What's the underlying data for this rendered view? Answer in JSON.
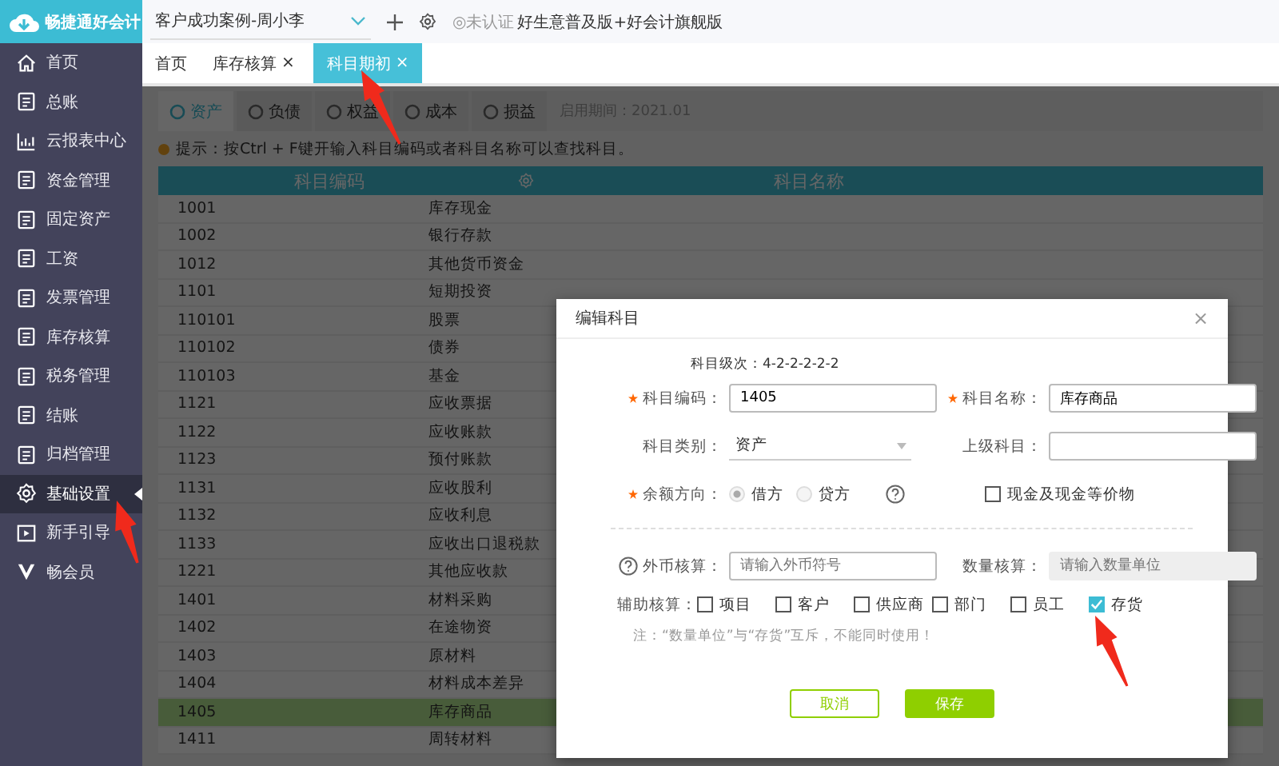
{
  "app": {
    "logo": "畅捷通好会计"
  },
  "sidebar": {
    "items": [
      {
        "label": "首页",
        "selected": false
      },
      {
        "label": "总账",
        "selected": false
      },
      {
        "label": "云报表中心",
        "selected": false
      },
      {
        "label": "资金管理",
        "selected": false
      },
      {
        "label": "固定资产",
        "selected": false
      },
      {
        "label": "工资",
        "selected": false
      },
      {
        "label": "发票管理",
        "selected": false
      },
      {
        "label": "库存核算",
        "selected": false
      },
      {
        "label": "税务管理",
        "selected": false
      },
      {
        "label": "结账",
        "selected": false
      },
      {
        "label": "归档管理",
        "selected": false
      },
      {
        "label": "基础设置",
        "selected": true
      },
      {
        "label": "新手引导",
        "selected": false
      },
      {
        "label": "畅会员",
        "selected": false
      }
    ]
  },
  "topbar": {
    "account": "客户成功案例-周小李",
    "cert": "◎未认证",
    "edition": "好生意普及版+好会计旗舰版"
  },
  "tabs": [
    {
      "label": "首页",
      "selected": false
    },
    {
      "label": "库存核算",
      "close": "×",
      "selected": false
    },
    {
      "label": "科目期初",
      "close": "×",
      "selected": true
    }
  ],
  "category_tabs": [
    {
      "label": "资产",
      "selected": true
    },
    {
      "label": "负债",
      "selected": false
    },
    {
      "label": "权益",
      "selected": false
    },
    {
      "label": "成本",
      "selected": false
    },
    {
      "label": "损益",
      "selected": false
    }
  ],
  "start_period": "启用期间：2021.01",
  "hint": "提示：按Ctrl + F键开输入科目编码或者科目名称可以查找科目。",
  "table": {
    "columns": [
      "科目编码",
      "科目名称"
    ],
    "rows": [
      {
        "code": "1001",
        "name": "库存现金",
        "selected": false
      },
      {
        "code": "1002",
        "name": "银行存款",
        "selected": false
      },
      {
        "code": "1012",
        "name": "其他货币资金",
        "selected": false
      },
      {
        "code": "1101",
        "name": "短期投资",
        "selected": false
      },
      {
        "code": "110101",
        "name": "股票",
        "selected": false
      },
      {
        "code": "110102",
        "name": "债券",
        "selected": false
      },
      {
        "code": "110103",
        "name": "基金",
        "selected": false
      },
      {
        "code": "1121",
        "name": "应收票据",
        "selected": false
      },
      {
        "code": "1122",
        "name": "应收账款",
        "selected": false
      },
      {
        "code": "1123",
        "name": "预付账款",
        "selected": false
      },
      {
        "code": "1131",
        "name": "应收股利",
        "selected": false
      },
      {
        "code": "1132",
        "name": "应收利息",
        "selected": false
      },
      {
        "code": "1133",
        "name": "应收出口退税款",
        "selected": false
      },
      {
        "code": "1221",
        "name": "其他应收款",
        "selected": false
      },
      {
        "code": "1401",
        "name": "材料采购",
        "selected": false
      },
      {
        "code": "1402",
        "name": "在途物资",
        "selected": false
      },
      {
        "code": "1403",
        "name": "原材料",
        "selected": false
      },
      {
        "code": "1404",
        "name": "材料成本差异",
        "selected": false
      },
      {
        "code": "1405",
        "name": "库存商品",
        "selected": true
      },
      {
        "code": "1411",
        "name": "周转材料",
        "selected": false
      }
    ]
  },
  "dialog": {
    "title": "编辑科目",
    "close": "×",
    "level_hint": "科目级次：4-2-2-2-2-2",
    "code": {
      "label": "科目编码：",
      "required": true,
      "value": "1405"
    },
    "name": {
      "label": "科目名称：",
      "required": true,
      "value": "库存商品"
    },
    "category": {
      "label": "科目类别：",
      "value": "资产"
    },
    "parent": {
      "label": "上级科目："
    },
    "direction": {
      "label": "余额方向：",
      "required": true,
      "options": [
        {
          "label": "借方",
          "selected": true
        },
        {
          "label": "贷方",
          "selected": false
        }
      ]
    },
    "cash": {
      "label": "现金及现金等价物",
      "checked": false
    },
    "foreign": {
      "label": "外币核算：",
      "placeholder": "请输入外币符号"
    },
    "quantity": {
      "label": "数量核算：",
      "placeholder": "请输入数量单位",
      "disabled": true
    },
    "auxiliary": {
      "label": "辅助核算：",
      "options": [
        {
          "label": "项目",
          "checked": false
        },
        {
          "label": "客户",
          "checked": false
        },
        {
          "label": "供应商",
          "checked": false
        },
        {
          "label": "部门",
          "checked": false
        },
        {
          "label": "员工",
          "checked": false
        },
        {
          "label": "存货",
          "checked": true
        }
      ]
    },
    "note": "注：“数量单位”与“存货”互斥，不能同时使用！",
    "buttons": [
      {
        "label": "取消",
        "kind": "secondary"
      },
      {
        "label": "保存",
        "kind": "primary"
      }
    ]
  }
}
